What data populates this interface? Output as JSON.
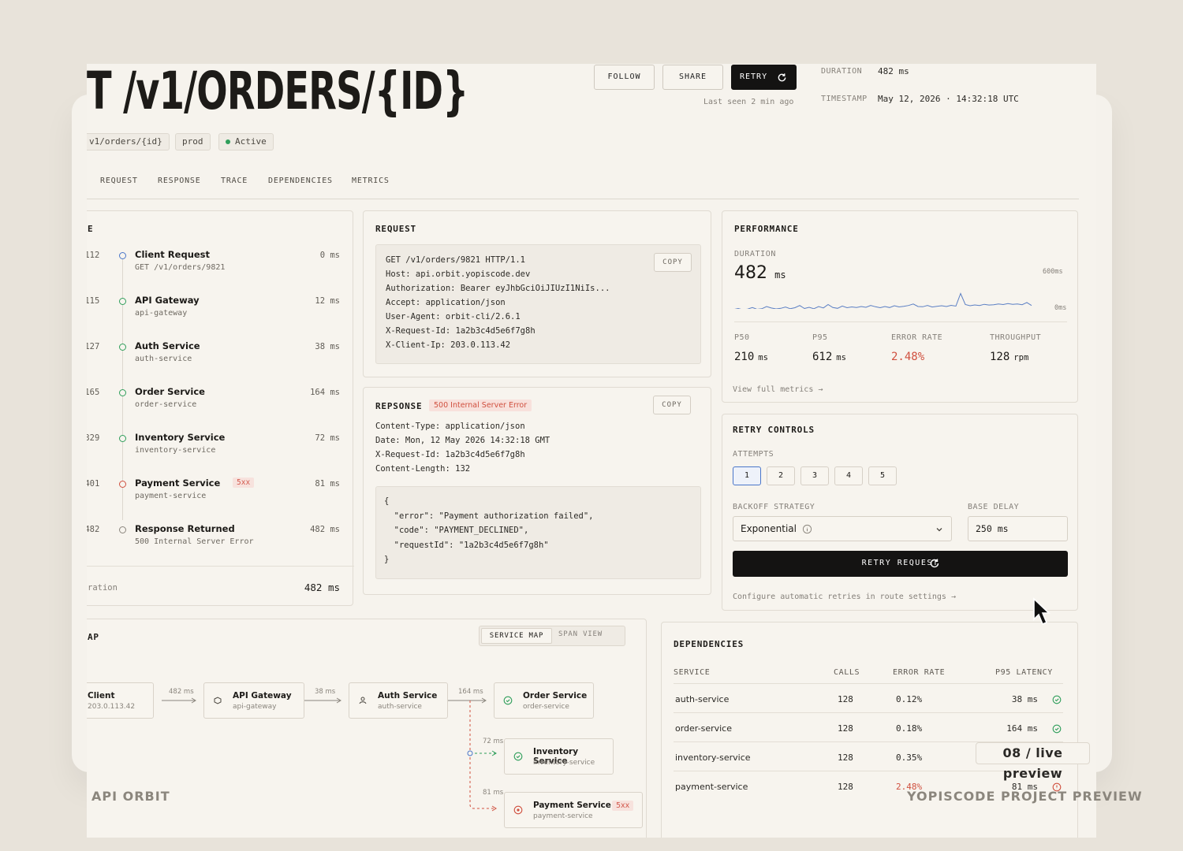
{
  "captions": {
    "left": "API ORBIT",
    "right": "YOPISCODE PROJECT PREVIEW",
    "live": "08 / live preview"
  },
  "header": {
    "title": "T /v1/ORDERS/{ID}",
    "chips": {
      "route": "v1/orders/{id}",
      "env": "prod",
      "status": "Active"
    },
    "buttons": {
      "follow": "FOLLOW",
      "share": "SHARE",
      "retry": "RETRY"
    },
    "last_seen": "Last seen 2 min ago",
    "meta": {
      "duration_label": "DURATION",
      "duration_value": "482 ms",
      "timestamp_label": "TIMESTAMP",
      "timestamp_value": "May 12, 2026 · 14:32:18 UTC"
    }
  },
  "tabs": [
    "REQUEST",
    "RESPONSE",
    "TRACE",
    "DEPENDENCIES",
    "METRICS"
  ],
  "timeline": {
    "title": "E",
    "items": [
      {
        "time": ".112",
        "name": "Client Request",
        "sub": "GET /v1/orders/9821",
        "ms": "0 ms",
        "state": "info"
      },
      {
        "time": ".115",
        "name": "API Gateway",
        "sub": "api-gateway",
        "ms": "12 ms",
        "state": "ok"
      },
      {
        "time": ".127",
        "name": "Auth Service",
        "sub": "auth-service",
        "ms": "38 ms",
        "state": "ok"
      },
      {
        "time": ".165",
        "name": "Order Service",
        "sub": "order-service",
        "ms": "164 ms",
        "state": "ok"
      },
      {
        "time": ".329",
        "name": "Inventory Service",
        "sub": "inventory-service",
        "ms": "72 ms",
        "state": "ok"
      },
      {
        "time": ".401",
        "name": "Payment Service",
        "sub": "payment-service",
        "ms": "81 ms",
        "state": "error",
        "badge": "5xx"
      },
      {
        "time": ".482",
        "name": "Response Returned",
        "sub": "500 Internal Server Error",
        "ms": "482 ms",
        "state": "neutral"
      }
    ],
    "footer_label": "ration",
    "footer_value": "482 ms"
  },
  "request": {
    "title": "REQUEST",
    "copy": "COPY",
    "lines": [
      "GET /v1/orders/9821 HTTP/1.1",
      "Host: api.orbit.yopiscode.dev",
      "Authorization: Bearer eyJhbGciOiJIUzI1NiIs...",
      "Accept: application/json",
      "User-Agent: orbit-cli/2.6.1",
      "X-Request-Id: 1a2b3c4d5e6f7g8h",
      "X-Client-Ip: 203.0.113.42"
    ]
  },
  "response": {
    "title": "REPSONSE",
    "status": "500 Internal Server Error",
    "copy": "COPY",
    "headers": [
      "Content-Type: application/json",
      "Date: Mon, 12 May 2026 14:32:18 GMT",
      "X-Request-Id: 1a2b3c4d5e6f7g8h",
      "Content-Length: 132"
    ],
    "body": [
      "{",
      "  \"error\": \"Payment authorization failed\",",
      "  \"code\": \"PAYMENT_DECLINED\",",
      "  \"requestId\": \"1a2b3c4d5e6f7g8h\"",
      "}"
    ]
  },
  "performance": {
    "title": "PERFORMANCE",
    "duration_label": "DURATION",
    "duration_value": "482",
    "duration_unit": "ms",
    "axis_max": "600ms",
    "axis_min": "0ms",
    "stats": [
      {
        "label": "P50",
        "value": "210",
        "unit": "ms",
        "color": "#1d1b18"
      },
      {
        "label": "P95",
        "value": "612",
        "unit": "ms",
        "color": "#1d1b18"
      },
      {
        "label": "ERROR RATE",
        "value": "2.48%",
        "unit": "",
        "color": "#d0503f"
      },
      {
        "label": "THROUGHPUT",
        "value": "128",
        "unit": "rpm",
        "color": "#1d1b18"
      }
    ],
    "link": "View full metrics →",
    "sparkline": [
      120,
      130,
      118,
      125,
      140,
      122,
      128,
      150,
      135,
      126,
      132,
      145,
      128,
      138,
      160,
      130,
      142,
      128,
      150,
      136,
      170,
      140,
      132,
      155,
      138,
      146,
      140,
      150,
      142,
      160,
      148,
      138,
      150,
      140,
      158,
      146,
      152,
      160,
      175,
      150,
      148,
      160,
      145,
      152,
      158,
      150,
      162,
      154,
      280,
      170,
      158,
      166,
      160,
      172,
      165,
      168,
      175,
      170,
      180,
      172,
      176,
      168,
      190,
      160
    ]
  },
  "retry": {
    "title": "RETRY CONTROLS",
    "attempts_label": "ATTEMPTS",
    "attempts": [
      "1",
      "2",
      "3",
      "4",
      "5"
    ],
    "backoff_label": "BACKOFF STRATEGY",
    "backoff_value": "Exponential",
    "delay_label": "BASE DELAY",
    "delay_value": "250 ms",
    "button": "RETRY REQUEST",
    "link": "Configure automatic retries in route settings →"
  },
  "map": {
    "title": "AP",
    "toggle_service": "SERVICE MAP",
    "toggle_span": "SPAN VIEW",
    "nodes": {
      "client": {
        "name": "Client",
        "sub": "203.0.113.42"
      },
      "gateway": {
        "name": "API Gateway",
        "sub": "api-gateway"
      },
      "auth": {
        "name": "Auth Service",
        "sub": "auth-service"
      },
      "order": {
        "name": "Order Service",
        "sub": "order-service"
      },
      "inventory": {
        "name": "Inventory Service",
        "sub": "inventory-service"
      },
      "payment": {
        "name": "Payment Service",
        "sub": "payment-service",
        "badge": "5xx"
      }
    },
    "edges": {
      "e1": "482 ms",
      "e2": "38 ms",
      "e3": "164 ms",
      "e4": "72 ms",
      "e5": "81 ms"
    }
  },
  "dependencies": {
    "title": "DEPENDENCIES",
    "headers": [
      "SERVICE",
      "CALLS",
      "ERROR RATE",
      "P95 LATENCY"
    ],
    "rows": [
      {
        "service": "auth-service",
        "calls": "128",
        "error": "0.12%",
        "p95": "38 ms",
        "state": "ok"
      },
      {
        "service": "order-service",
        "calls": "128",
        "error": "0.18%",
        "p95": "164 ms",
        "state": "ok"
      },
      {
        "service": "inventory-service",
        "calls": "128",
        "error": "0.35%",
        "p95": "",
        "state": "ok"
      },
      {
        "service": "payment-service",
        "calls": "128",
        "error": "2.48%",
        "p95": "81 ms",
        "state": "error"
      }
    ]
  }
}
